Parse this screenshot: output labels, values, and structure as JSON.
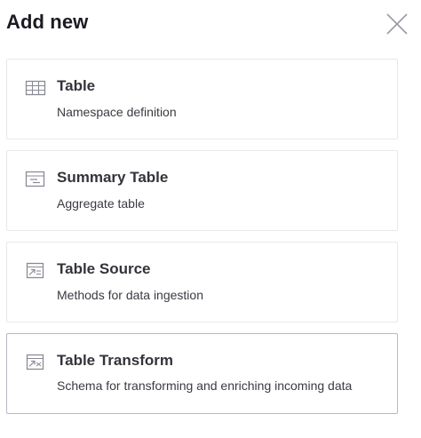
{
  "dialog": {
    "title": "Add new",
    "close_icon": "close-icon"
  },
  "options": [
    {
      "icon": "table-grid-icon",
      "name": "Table",
      "description": "Namespace definition"
    },
    {
      "icon": "summary-table-icon",
      "name": "Summary Table",
      "description": "Aggregate table"
    },
    {
      "icon": "table-source-icon",
      "name": "Table Source",
      "description": "Methods for data ingestion"
    },
    {
      "icon": "table-transform-icon",
      "name": "Table Transform",
      "description": "Schema for transforming and enriching incoming data"
    }
  ],
  "colors": {
    "icon": "#8a8a96",
    "card_border": "#e8e8ec",
    "selected_border": "#b8b8c6"
  }
}
